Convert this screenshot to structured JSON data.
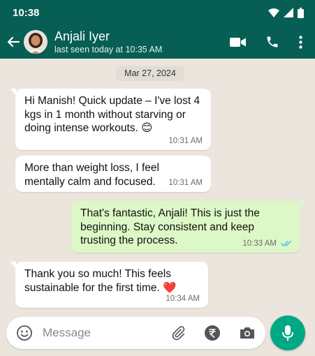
{
  "status_bar": {
    "time": "10:38"
  },
  "header": {
    "contact_name": "Anjali Iyer",
    "contact_status": "last seen today at 10:35 AM"
  },
  "chat": {
    "date_chip": "Mar 27, 2024",
    "messages": [
      {
        "direction": "in",
        "text": "Hi Manish! Quick update – I've lost 4 kgs in 1 month without starving or doing intense workouts. 😊",
        "time": "10:31 AM"
      },
      {
        "direction": "in",
        "text": "More than weight loss, I feel mentally calm and focused.",
        "time": "10:31 AM"
      },
      {
        "direction": "out",
        "text": "That's fantastic, Anjali! This is just the beginning. Stay consistent and keep trusting the process.",
        "time": "10:33 AM",
        "status": "read"
      },
      {
        "direction": "in",
        "text": "Thank you so much! This feels sustainable for the first time. ❤️",
        "time": "10:34 AM"
      }
    ]
  },
  "composer": {
    "placeholder": "Message"
  },
  "colors": {
    "header": "#075e54",
    "incoming_bubble": "#ffffff",
    "outgoing_bubble": "#dcf8c6",
    "chat_background": "#ece5dd",
    "read_ticks": "#53bdeb",
    "mic_button": "#00a884"
  }
}
